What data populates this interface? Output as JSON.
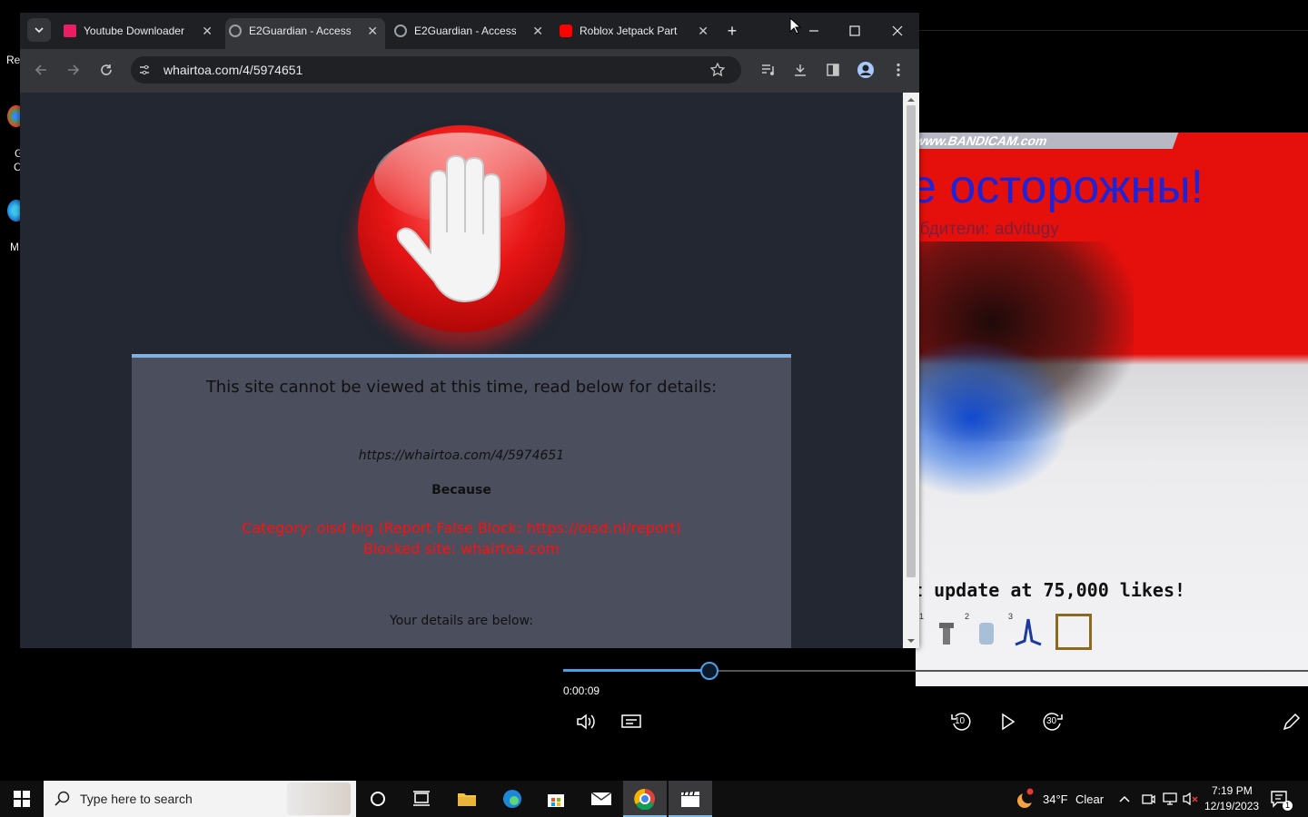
{
  "desktop": {
    "labels": [
      "Re",
      "G",
      "C",
      "M"
    ]
  },
  "browser": {
    "tabs": [
      {
        "title": "Youtube Downloader",
        "icon": "youtube-downloader-icon",
        "active": false
      },
      {
        "title": "E2Guardian - Access",
        "icon": "globe-icon",
        "active": true
      },
      {
        "title": "E2Guardian - Access",
        "icon": "globe-icon",
        "active": false
      },
      {
        "title": "Roblox Jetpack Part",
        "icon": "youtube-icon",
        "active": false
      }
    ],
    "close_glyph": "✕",
    "new_tab_glyph": "+",
    "url": "whairtoa.com/4/5974651"
  },
  "block_page": {
    "heading": "This site cannot be viewed at this time, read below for details:",
    "blocked_url": "https://whairtoa.com/4/5974651",
    "because": "Because",
    "category": "Category: oisd big (Report False Block: https://oisd.nl/report)",
    "blocked_site": "Blocked site: whairtoa.com",
    "details": "Your details are below:"
  },
  "player": {
    "video": {
      "watermark": "www.BANDICAM.com",
      "headline": "е осторожны!",
      "subline": "обдители: advitugy",
      "likes_text": "t update at 75,000 likes!",
      "slots": [
        "1",
        "2",
        "3"
      ]
    },
    "timecode": "0:00:09",
    "progress_fraction": 0.195,
    "skip_back": "10",
    "skip_forward": "30"
  },
  "taskbar": {
    "search_placeholder": "Type here to search",
    "weather_temp": "34°F",
    "weather_cond": "Clear",
    "time": "7:19 PM",
    "date": "12/19/2023",
    "notification_count": "1"
  },
  "colors": {
    "accent": "#4aa0e6",
    "block_red": "#ff1010",
    "panel": "#4a4e5d"
  }
}
